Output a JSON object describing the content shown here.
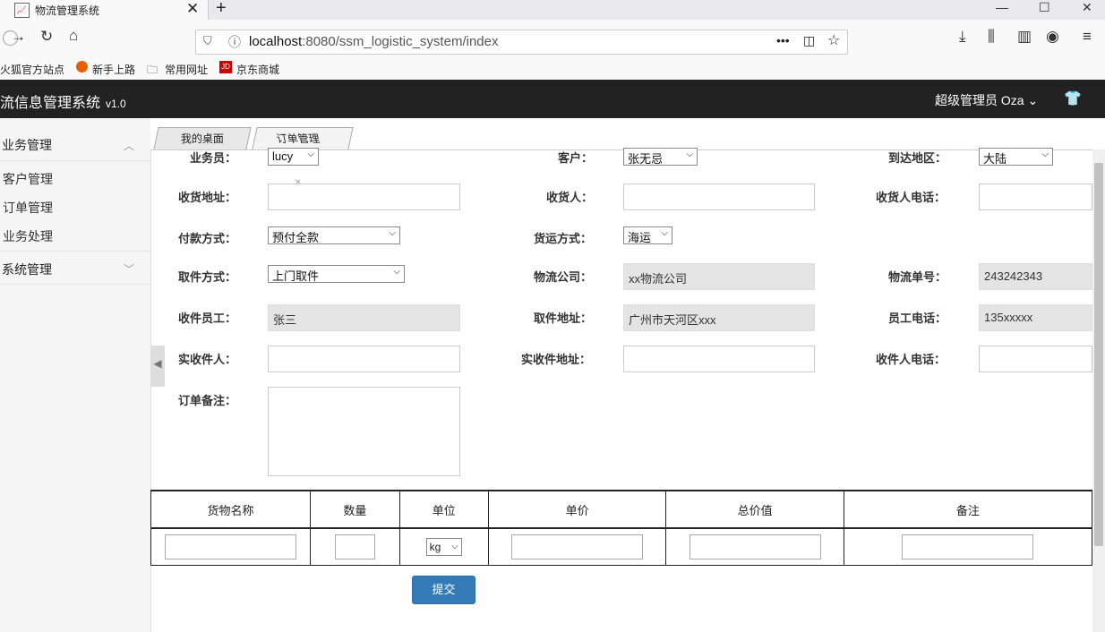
{
  "browser": {
    "tab_title": "物流管理系统",
    "url_host": "localhost",
    "url_rest": ":8080/ssm_logistic_system/index",
    "bookmarks": [
      "火狐官方站点",
      "新手上路",
      "常用网址",
      "京东商城"
    ],
    "bookmark_jd_badge": "JD"
  },
  "app": {
    "brand": "流信息管理系统",
    "version": "v1.0",
    "user_role": "超级管理员",
    "user_name": "Oza"
  },
  "sidebar": {
    "groups": [
      {
        "label": "业务管理",
        "items": [
          "客户管理",
          "订单管理",
          "业务处理"
        ]
      },
      {
        "label": "系统管理",
        "items": []
      }
    ]
  },
  "page_tabs": [
    {
      "label": "我的桌面"
    },
    {
      "label": "订单管理",
      "close": "×"
    }
  ],
  "form": {
    "row1": {
      "salesman_label": "业务员：",
      "salesman_value": "lucy",
      "customer_label": "客户：",
      "customer_value": "张无忌",
      "region_label": "到达地区：",
      "region_value": "大陆"
    },
    "row2": {
      "ship_addr_label": "收货地址：",
      "ship_addr_value": "",
      "receiver_label": "收货人：",
      "receiver_value": "",
      "receiver_phone_label": "收货人电话：",
      "receiver_phone_value": ""
    },
    "row3": {
      "payment_label": "付款方式：",
      "payment_value": "预付全款",
      "shipping_label": "货运方式：",
      "shipping_value": "海运"
    },
    "row4": {
      "pickup_label": "取件方式：",
      "pickup_value": "上门取件",
      "company_label": "物流公司：",
      "company_value": "xx物流公司",
      "tracking_label": "物流单号：",
      "tracking_value": "243242343"
    },
    "row5": {
      "staff_label": "收件员工：",
      "staff_value": "张三",
      "pickup_addr_label": "取件地址：",
      "pickup_addr_value": "广州市天河区xxx",
      "staff_phone_label": "员工电话：",
      "staff_phone_value": "135xxxxx"
    },
    "row6": {
      "actual_receiver_label": "实收件人：",
      "actual_receiver_value": "",
      "actual_addr_label": "实收件地址：",
      "actual_addr_value": "",
      "sender_phone_label": "收件人电话：",
      "sender_phone_value": ""
    },
    "remark_label": "订单备注："
  },
  "goods_table": {
    "headers": [
      "货物名称",
      "数量",
      "单位",
      "单价",
      "总价值",
      "备注"
    ],
    "unit_value": "kg"
  },
  "submit_label": "提交"
}
